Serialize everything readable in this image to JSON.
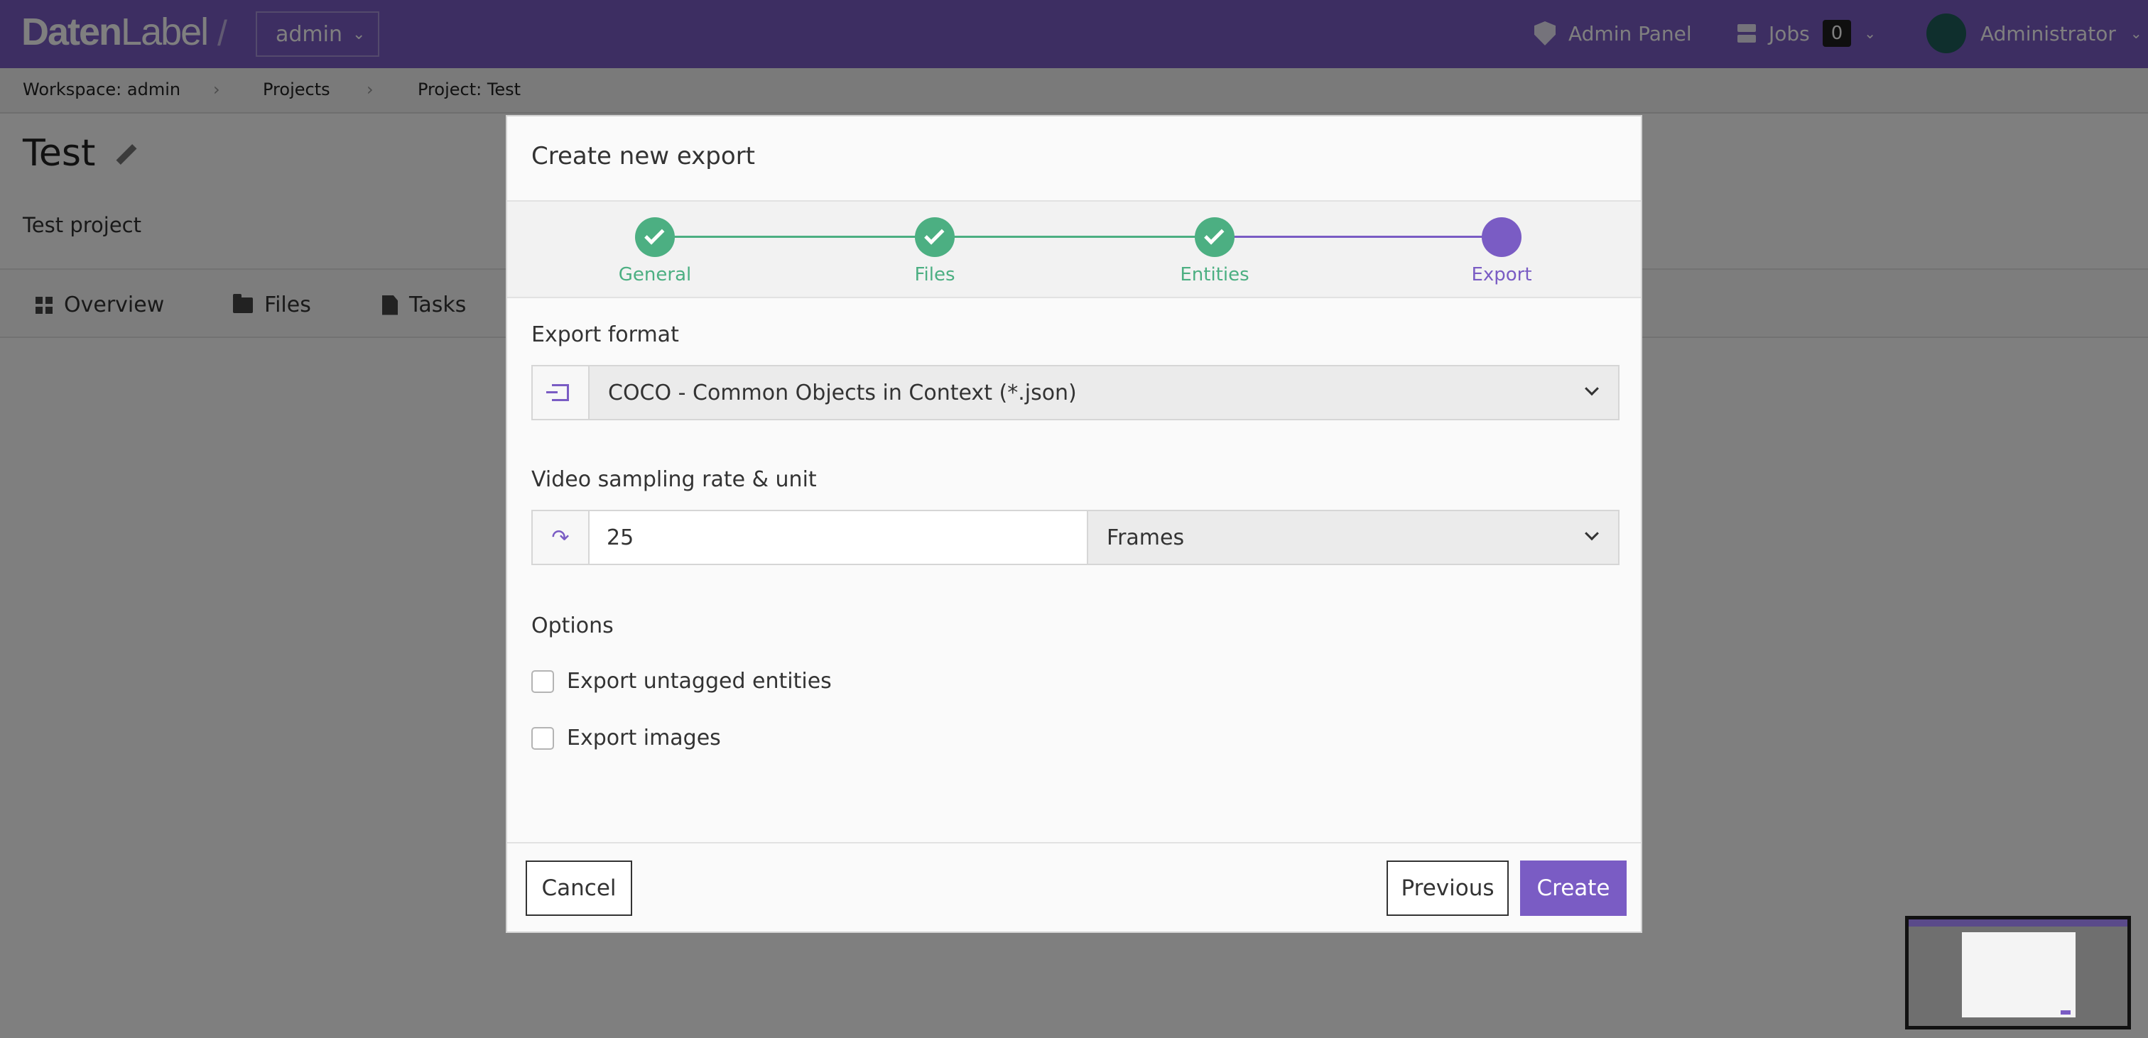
{
  "app": {
    "logo_bold": "Daten",
    "logo_light": "Label",
    "workspace_select": "admin",
    "admin_panel": "Admin Panel",
    "jobs_label": "Jobs",
    "jobs_count": "0",
    "user_name": "Administrator"
  },
  "breadcrumb": {
    "items": [
      "Workspace: admin",
      "Projects",
      "Project: Test"
    ],
    "separator": "›"
  },
  "page": {
    "title": "Test",
    "subtitle": "Test project",
    "tabs": [
      "Overview",
      "Files",
      "Tasks"
    ]
  },
  "modal": {
    "title": "Create new export",
    "steps": [
      {
        "label": "General",
        "state": "done"
      },
      {
        "label": "Files",
        "state": "done"
      },
      {
        "label": "Entities",
        "state": "done"
      },
      {
        "label": "Export",
        "state": "active"
      }
    ],
    "export_format": {
      "label": "Export format",
      "selected": "COCO - Common Objects in Context (*.json)",
      "icon": "sign-in-icon"
    },
    "sampling": {
      "label": "Video sampling rate & unit",
      "value": "25",
      "unit": "Frames",
      "icon": "redo-icon"
    },
    "options": {
      "label": "Options",
      "items": [
        {
          "label": "Export untagged entities",
          "checked": false
        },
        {
          "label": "Export images",
          "checked": false
        }
      ]
    },
    "buttons": {
      "cancel": "Cancel",
      "previous": "Previous",
      "create": "Create"
    }
  },
  "colors": {
    "brand": "#7a5cc4",
    "step_done": "#4caf82",
    "overlay": "rgba(0,0,0,0.5)"
  }
}
